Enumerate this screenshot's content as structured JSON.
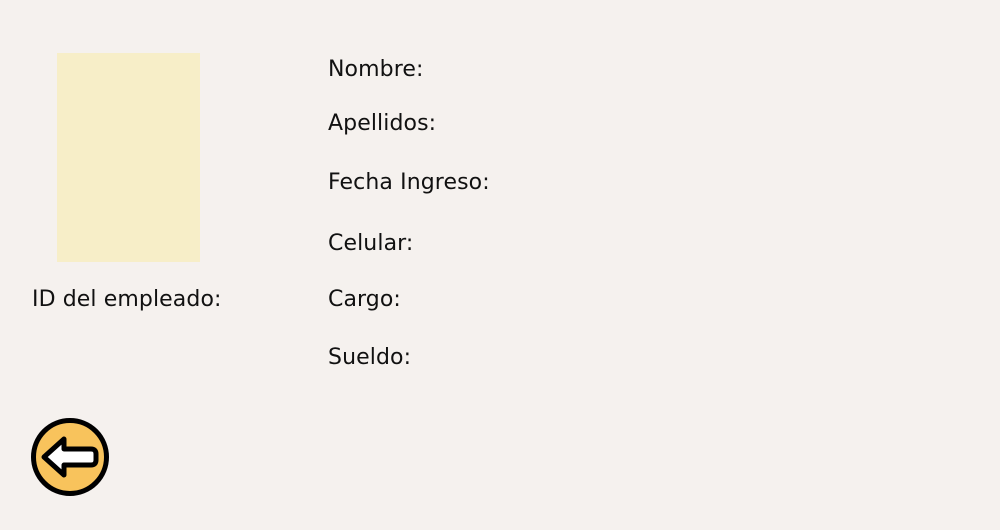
{
  "employee": {
    "photo_placeholder_color": "#f7eec8",
    "id_label": "ID del empleado:"
  },
  "fields": {
    "nombre_label": "Nombre:",
    "apellidos_label": "Apellidos:",
    "fecha_ingreso_label": "Fecha Ingreso:",
    "celular_label": "Celular:",
    "cargo_label": "Cargo:",
    "sueldo_label": "Sueldo:"
  },
  "back_button": {
    "icon": "arrow-left-icon",
    "color": "#f8c35c"
  }
}
